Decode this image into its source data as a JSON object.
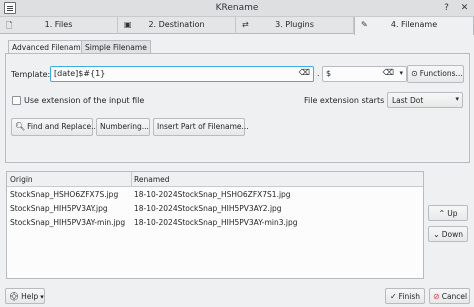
{
  "window": {
    "title": "KRename",
    "app_icon": "krename-icon",
    "controls": [
      "help-icon",
      "close-icon"
    ]
  },
  "steps": [
    {
      "label": "1. Files",
      "icon": "files-icon",
      "glyph": "🗋"
    },
    {
      "label": "2. Destination",
      "icon": "destination-icon",
      "glyph": "▣"
    },
    {
      "label": "3. Plugins",
      "icon": "plugins-icon",
      "glyph": "⇄"
    },
    {
      "label": "4. Filename",
      "icon": "edit-icon",
      "glyph": "✎"
    }
  ],
  "subtabs": {
    "advanced": "Advanced Filename",
    "simple": "Simple Filename"
  },
  "template": {
    "label": "Template:",
    "value": "[date]$#{1}",
    "separator": ".",
    "extension_value": "$",
    "functions_label": "Functions..."
  },
  "options": {
    "use_extension_label": "Use extension of the input file",
    "use_extension_checked": false,
    "ext_starts_label": "File extension starts at:",
    "ext_starts_value": "Last Dot"
  },
  "actions": {
    "find_replace": "Find and Replace...",
    "numbering": "Numbering...",
    "insert_part": "Insert Part of Filename..."
  },
  "table": {
    "columns": [
      "Origin",
      "Renamed"
    ],
    "rows": [
      {
        "origin": "StockSnap_HSHO6ZFX7S.jpg",
        "renamed": "18-10-2024StockSnap_HSHO6ZFX7S1.jpg"
      },
      {
        "origin": "StockSnap_HIH5PV3AY.jpg",
        "renamed": "18-10-2024StockSnap_HIH5PV3AY2.jpg"
      },
      {
        "origin": "StockSnap_HIH5PV3AY-min.jpg",
        "renamed": "18-10-2024StockSnap_HIH5PV3AY-min3.jpg"
      }
    ]
  },
  "side": {
    "up": "Up",
    "down": "Down"
  },
  "footer": {
    "help": "Help",
    "finish": "Finish",
    "cancel": "Cancel"
  },
  "colors": {
    "accent": "#3daee9",
    "cancel_icon": "#da4453"
  }
}
